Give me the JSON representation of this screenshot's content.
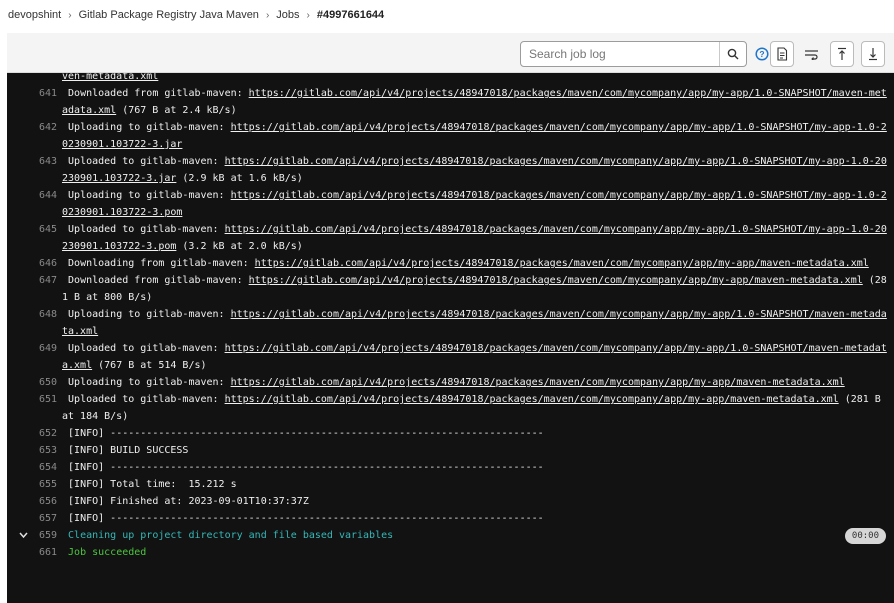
{
  "breadcrumb": {
    "items": [
      "devopshint",
      "Gitlab Package Registry Java Maven",
      "Jobs"
    ],
    "current": "#4997661644"
  },
  "toolbar": {
    "search_placeholder": "Search job log",
    "buttons": [
      "search-icon",
      "help-icon",
      "raw-log-icon",
      "wrap-icon",
      "scroll-top-icon",
      "scroll-bottom-icon"
    ]
  },
  "log": {
    "top_fragment": "ven-metadata.xml",
    "lines": [
      {
        "num": "641",
        "prefix": " Downloaded from gitlab-maven: ",
        "url": "https://gitlab.com/api/v4/projects/48947018/packages/maven/com/mycompany/app/my-app/1.0-SNAPSHOT/maven-metadata.xml",
        "suffix": " (767 B at 2.4 kB/s)"
      },
      {
        "num": "642",
        "prefix": " Uploading to gitlab-maven: ",
        "url": "https://gitlab.com/api/v4/projects/48947018/packages/maven/com/mycompany/app/my-app/1.0-SNAPSHOT/my-app-1.0-20230901.103722-3.jar",
        "suffix": ""
      },
      {
        "num": "643",
        "prefix": " Uploaded to gitlab-maven: ",
        "url": "https://gitlab.com/api/v4/projects/48947018/packages/maven/com/mycompany/app/my-app/1.0-SNAPSHOT/my-app-1.0-20230901.103722-3.jar",
        "suffix": " (2.9 kB at 1.6 kB/s)"
      },
      {
        "num": "644",
        "prefix": " Uploading to gitlab-maven: ",
        "url": "https://gitlab.com/api/v4/projects/48947018/packages/maven/com/mycompany/app/my-app/1.0-SNAPSHOT/my-app-1.0-20230901.103722-3.pom",
        "suffix": ""
      },
      {
        "num": "645",
        "prefix": " Uploaded to gitlab-maven: ",
        "url": "https://gitlab.com/api/v4/projects/48947018/packages/maven/com/mycompany/app/my-app/1.0-SNAPSHOT/my-app-1.0-20230901.103722-3.pom",
        "suffix": " (3.2 kB at 2.0 kB/s)"
      },
      {
        "num": "646",
        "prefix": " Downloading from gitlab-maven: ",
        "url": "https://gitlab.com/api/v4/projects/48947018/packages/maven/com/mycompany/app/my-app/maven-metadata.xml",
        "suffix": ""
      },
      {
        "num": "647",
        "prefix": " Downloaded from gitlab-maven: ",
        "url": "https://gitlab.com/api/v4/projects/48947018/packages/maven/com/mycompany/app/my-app/maven-metadata.xml",
        "suffix": " (281 B at 800 B/s)"
      },
      {
        "num": "648",
        "prefix": " Uploading to gitlab-maven: ",
        "url": "https://gitlab.com/api/v4/projects/48947018/packages/maven/com/mycompany/app/my-app/1.0-SNAPSHOT/maven-metadata.xml",
        "suffix": ""
      },
      {
        "num": "649",
        "prefix": " Uploaded to gitlab-maven: ",
        "url": "https://gitlab.com/api/v4/projects/48947018/packages/maven/com/mycompany/app/my-app/1.0-SNAPSHOT/maven-metadata.xml",
        "suffix": " (767 B at 514 B/s)"
      },
      {
        "num": "650",
        "prefix": " Uploading to gitlab-maven: ",
        "url": "https://gitlab.com/api/v4/projects/48947018/packages/maven/com/mycompany/app/my-app/maven-metadata.xml",
        "suffix": ""
      },
      {
        "num": "651",
        "prefix": " Uploaded to gitlab-maven: ",
        "url": "https://gitlab.com/api/v4/projects/48947018/packages/maven/com/mycompany/app/my-app/maven-metadata.xml",
        "suffix": " (281 B at 184 B/s)"
      },
      {
        "num": "652",
        "prefix": " [INFO] ------------------------------------------------------------------------",
        "url": "",
        "suffix": ""
      },
      {
        "num": "653",
        "prefix": " [INFO] BUILD SUCCESS",
        "url": "",
        "suffix": ""
      },
      {
        "num": "654",
        "prefix": " [INFO] ------------------------------------------------------------------------",
        "url": "",
        "suffix": ""
      },
      {
        "num": "655",
        "prefix": " [INFO] Total time:  15.212 s",
        "url": "",
        "suffix": ""
      },
      {
        "num": "656",
        "prefix": " [INFO] Finished at: 2023-09-01T10:37:37Z",
        "url": "",
        "suffix": ""
      },
      {
        "num": "657",
        "prefix": " [INFO] ------------------------------------------------------------------------",
        "url": "",
        "suffix": ""
      }
    ],
    "section": {
      "num": "659",
      "text": " Cleaning up project directory and file based variables",
      "duration": "00:00"
    },
    "final": {
      "num": "661",
      "text": " Job succeeded"
    }
  },
  "colors": {
    "log_bg": "#121212",
    "section_text": "#35b7b7",
    "success_text": "#4dc63f",
    "line_number": "#8a8a8a"
  }
}
